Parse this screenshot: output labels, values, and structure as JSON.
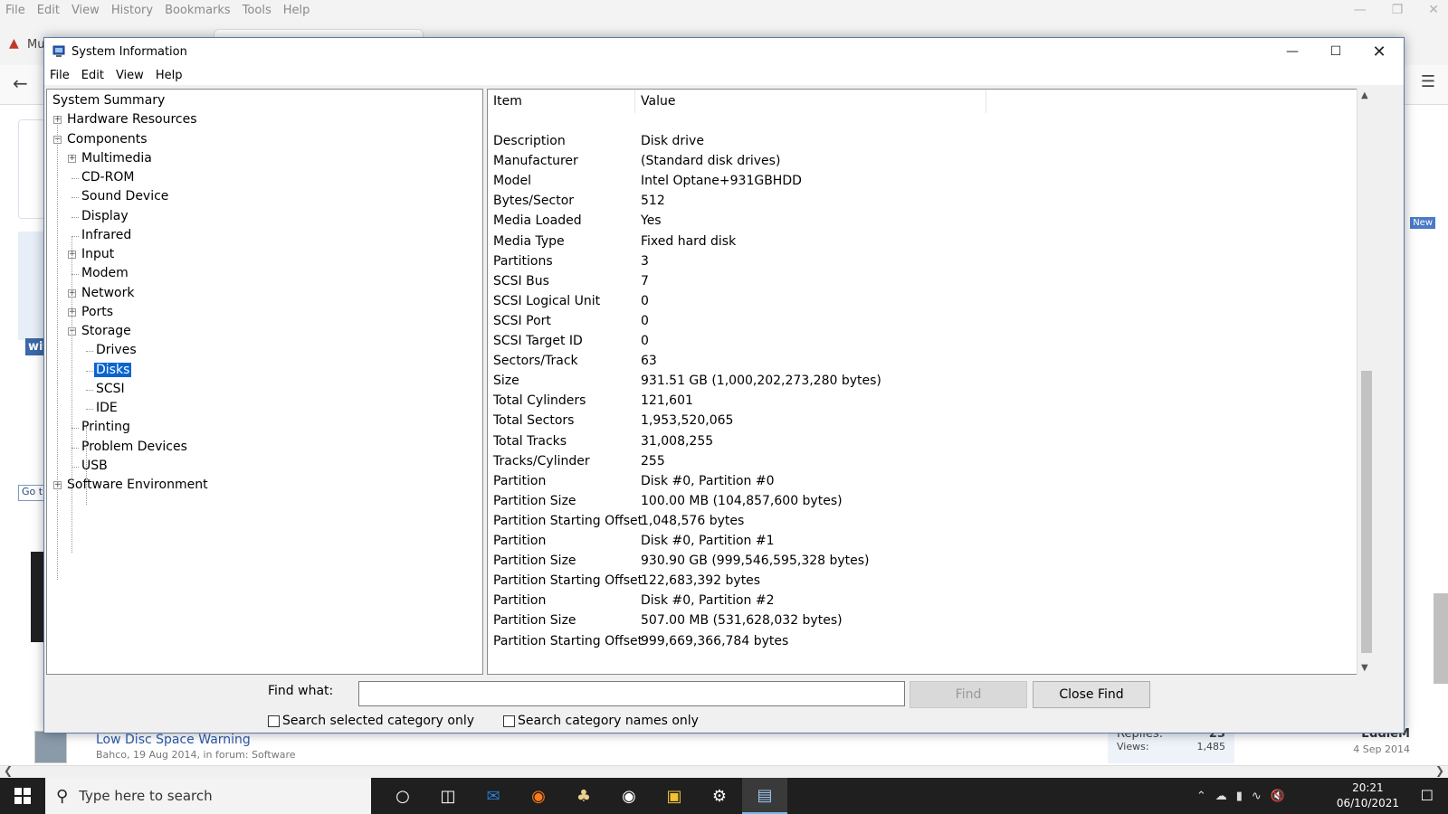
{
  "browser": {
    "menu": [
      "File",
      "Edit",
      "View",
      "History",
      "Bookmarks",
      "Tools",
      "Help"
    ],
    "tab_label": "Mu",
    "badge_new": "New",
    "sidebar_blue": "wit",
    "goto_label": "Go t",
    "thread": {
      "title": "Low Disc Space Warning",
      "meta": "Bahco, 19 Aug 2014, in forum: Software",
      "replies_label": "Replies:",
      "replies_value": "23",
      "views_label": "Views:",
      "views_value": "1,485",
      "last_user": "EddieM",
      "last_date": "4 Sep 2014"
    }
  },
  "window": {
    "title": "System Information",
    "menu": [
      "File",
      "Edit",
      "View",
      "Help"
    ]
  },
  "tree": [
    {
      "label": "System Summary",
      "level": 0,
      "expander": "none"
    },
    {
      "label": "Hardware Resources",
      "level": 1,
      "expander": "plus"
    },
    {
      "label": "Components",
      "level": 1,
      "expander": "minus"
    },
    {
      "label": "Multimedia",
      "level": 2,
      "expander": "plus"
    },
    {
      "label": "CD-ROM",
      "level": 2,
      "expander": "none"
    },
    {
      "label": "Sound Device",
      "level": 2,
      "expander": "none"
    },
    {
      "label": "Display",
      "level": 2,
      "expander": "none"
    },
    {
      "label": "Infrared",
      "level": 2,
      "expander": "none"
    },
    {
      "label": "Input",
      "level": 2,
      "expander": "plus"
    },
    {
      "label": "Modem",
      "level": 2,
      "expander": "none"
    },
    {
      "label": "Network",
      "level": 2,
      "expander": "plus"
    },
    {
      "label": "Ports",
      "level": 2,
      "expander": "plus"
    },
    {
      "label": "Storage",
      "level": 2,
      "expander": "minus"
    },
    {
      "label": "Drives",
      "level": 3,
      "expander": "none"
    },
    {
      "label": "Disks",
      "level": 3,
      "expander": "none",
      "selected": true
    },
    {
      "label": "SCSI",
      "level": 3,
      "expander": "none"
    },
    {
      "label": "IDE",
      "level": 3,
      "expander": "none"
    },
    {
      "label": "Printing",
      "level": 2,
      "expander": "none"
    },
    {
      "label": "Problem Devices",
      "level": 2,
      "expander": "none"
    },
    {
      "label": "USB",
      "level": 2,
      "expander": "none"
    },
    {
      "label": "Software Environment",
      "level": 1,
      "expander": "plus"
    }
  ],
  "details": {
    "columns": [
      "Item",
      "Value"
    ],
    "rows": [
      [
        "Description",
        "Disk drive"
      ],
      [
        "Manufacturer",
        "(Standard disk drives)"
      ],
      [
        "Model",
        "Intel Optane+931GBHDD"
      ],
      [
        "Bytes/Sector",
        "512"
      ],
      [
        "Media Loaded",
        "Yes"
      ],
      [
        "Media Type",
        "Fixed hard disk"
      ],
      [
        "Partitions",
        "3"
      ],
      [
        "SCSI Bus",
        "7"
      ],
      [
        "SCSI Logical Unit",
        "0"
      ],
      [
        "SCSI Port",
        "0"
      ],
      [
        "SCSI Target ID",
        "0"
      ],
      [
        "Sectors/Track",
        "63"
      ],
      [
        "Size",
        "931.51 GB (1,000,202,273,280 bytes)"
      ],
      [
        "Total Cylinders",
        "121,601"
      ],
      [
        "Total Sectors",
        "1,953,520,065"
      ],
      [
        "Total Tracks",
        "31,008,255"
      ],
      [
        "Tracks/Cylinder",
        "255"
      ],
      [
        "Partition",
        "Disk #0, Partition #0"
      ],
      [
        "Partition Size",
        "100.00 MB (104,857,600 bytes)"
      ],
      [
        "Partition Starting Offset",
        "1,048,576 bytes"
      ],
      [
        "Partition",
        "Disk #0, Partition #1"
      ],
      [
        "Partition Size",
        "930.90 GB (999,546,595,328 bytes)"
      ],
      [
        "Partition Starting Offset",
        "122,683,392 bytes"
      ],
      [
        "Partition",
        "Disk #0, Partition #2"
      ],
      [
        "Partition Size",
        "507.00 MB (531,628,032 bytes)"
      ],
      [
        "Partition Starting Offset",
        "999,669,366,784 bytes"
      ]
    ]
  },
  "find": {
    "label": "Find what:",
    "value": "",
    "find_button": "Find",
    "close_button": "Close Find",
    "check1": "Search selected category only",
    "check2": "Search category names only"
  },
  "taskbar": {
    "search_placeholder": "Type here to search",
    "time": "20:21",
    "date": "06/10/2021"
  }
}
